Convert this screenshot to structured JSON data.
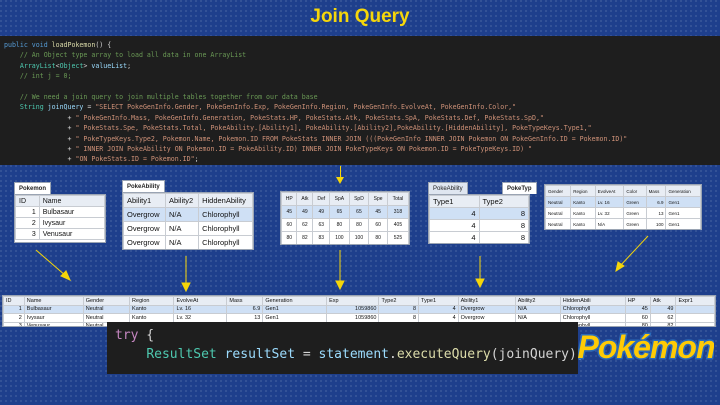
{
  "title": "Join Query",
  "code_lines": [
    {
      "parts": [
        [
          "kw",
          "public void "
        ],
        [
          "fn",
          "loadPokemon"
        ],
        [
          "",
          "() {"
        ]
      ]
    },
    {
      "parts": [
        [
          "cm",
          "    // An Object type array to load all data in one ArrayList"
        ]
      ]
    },
    {
      "parts": [
        [
          "ty",
          "    ArrayList"
        ],
        [
          "",
          "<"
        ],
        [
          "ty",
          "Object"
        ],
        [
          "",
          "> "
        ],
        [
          "id",
          "valueList"
        ],
        [
          "",
          ";"
        ]
      ]
    },
    {
      "parts": [
        [
          "cm",
          "    // int j = 0;"
        ]
      ]
    },
    {
      "parts": [
        [
          "",
          ""
        ]
      ]
    },
    {
      "parts": [
        [
          "cm",
          "    // We need a join query to join multiple tables together from our data base"
        ]
      ]
    },
    {
      "parts": [
        [
          "ty",
          "    String "
        ],
        [
          "id",
          "joinQuery"
        ],
        [
          "",
          " = "
        ],
        [
          "st",
          "\"SELECT PokeGenInfo.Gender, PokeGenInfo.Exp, PokeGenInfo.Region, PokeGenInfo.EvolveAt, PokeGenInfo.Color,\""
        ]
      ]
    },
    {
      "parts": [
        [
          "",
          "                + "
        ],
        [
          "st",
          "\" PokeGenInfo.Mass, PokeGenInfo.Generation, PokeStats.HP, PokeStats.Atk, PokeStats.SpA, PokeStats.Def, PokeStats.SpD,\""
        ]
      ]
    },
    {
      "parts": [
        [
          "",
          "                + "
        ],
        [
          "st",
          "\" PokeStats.Spe, PokeStats.Total, PokeAbility.[Ability1], PokeAbility.[Ability2],PokeAbility.[HiddenAbility], PokeTypeKeys.Type1,\""
        ]
      ]
    },
    {
      "parts": [
        [
          "",
          "                + "
        ],
        [
          "st",
          "\" PokeTypeKeys.Type2, Pokemon.Name, Pokemon.ID FROM PokeStats INNER JOIN (((PokeGenInfo INNER JOIN Pokemon ON PokeGenInfo.ID = Pokemon.ID)\""
        ]
      ]
    },
    {
      "parts": [
        [
          "",
          "                + "
        ],
        [
          "st",
          "\" INNER JOIN PokeAbility ON Pokemon.ID = PokeAbility.ID) INNER JOIN PokeTypeKeys ON Pokemon.ID = PokeTypeKeys.ID) \""
        ]
      ]
    },
    {
      "parts": [
        [
          "",
          "                + "
        ],
        [
          "st",
          "\"ON PokeStats.ID = Pokemon.ID\""
        ],
        [
          "",
          ";"
        ]
      ]
    }
  ],
  "pokemon_table": {
    "tab": "Pokemon",
    "headers": [
      "ID",
      "Name"
    ],
    "rows": [
      [
        "1",
        "Bulbasaur"
      ],
      [
        "2",
        "Ivysaur"
      ],
      [
        "3",
        "Venusaur"
      ]
    ]
  },
  "ability_table": {
    "tab": "PokeAbility",
    "headers": [
      "Ability1",
      "Ability2",
      "HiddenAbility"
    ],
    "rows": [
      [
        "Overgrow",
        "N/A",
        "Chlorophyll"
      ],
      [
        "Overgrow",
        "N/A",
        "Chlorophyll"
      ],
      [
        "Overgrow",
        "N/A",
        "Chlorophyll"
      ]
    ]
  },
  "stats_table": {
    "headers": [
      "HP",
      "Atk",
      "Def",
      "SpA",
      "SpD",
      "Spe",
      "Total"
    ],
    "rows": [
      [
        "45",
        "49",
        "49",
        "65",
        "65",
        "45",
        "318"
      ],
      [
        "60",
        "62",
        "63",
        "80",
        "80",
        "60",
        "405"
      ],
      [
        "80",
        "82",
        "83",
        "100",
        "100",
        "80",
        "525"
      ]
    ]
  },
  "types_table": {
    "tabs": [
      "PokeAbility",
      "PokeTyp"
    ],
    "headers": [
      "Type1",
      "Type2"
    ],
    "rows": [
      [
        "4",
        "8"
      ],
      [
        "4",
        "8"
      ],
      [
        "4",
        "8"
      ]
    ]
  },
  "info_table": {
    "headers": [
      "Gender",
      "Region",
      "EvolveAt",
      "Color",
      "Mass",
      "Generation"
    ],
    "rows": [
      [
        "Neutral",
        "Kanto",
        "Lv. 16",
        "Green",
        "6.9",
        "Gen1"
      ],
      [
        "Neutral",
        "Kanto",
        "Lv. 32",
        "Green",
        "13",
        "Gen1"
      ],
      [
        "Neutral",
        "Kanto",
        "N/A",
        "Green",
        "100",
        "Gen1"
      ]
    ]
  },
  "result_table": {
    "headers": [
      "ID",
      "Name",
      "Gender",
      "Region",
      "EvolveAt",
      "Mass",
      "Generation",
      "Exp",
      "Type2",
      "Type1",
      "Ability1",
      "Ability2",
      "HiddenAbili",
      "HP",
      "Atk",
      "Expr1"
    ],
    "rows": [
      [
        "1",
        "Bulbasaur",
        "Neutral",
        "Kanto",
        "Lv. 16",
        "6.9",
        "Gen1",
        "1059860",
        "8",
        "4",
        "Overgrow",
        "N/A",
        "Chlorophyll",
        "45",
        "49",
        ""
      ],
      [
        "2",
        "Ivysaur",
        "Neutral",
        "Kanto",
        "Lv. 32",
        "13",
        "Gen1",
        "1059860",
        "8",
        "4",
        "Overgrow",
        "N/A",
        "Chlorophyll",
        "60",
        "62",
        ""
      ],
      [
        "3",
        "Venusaur",
        "Neutral",
        "Kanto",
        "N/A",
        "100",
        "Gen1",
        "1059860",
        "8",
        "4",
        "Overgrow",
        "N/A",
        "Chlorophyll",
        "80",
        "82",
        ""
      ]
    ]
  },
  "try_code": {
    "line1_kw": "try",
    "line1_rest": " {",
    "line2_type": "ResultSet",
    "line2_var": " resultSet",
    "line2_eq": " = ",
    "line2_obj": "statement",
    "line2_dot": ".",
    "line2_fn": "executeQuery",
    "line2_args": "(joinQuery);"
  },
  "logo_text": "Pokémon",
  "colors": {
    "accent": "#f5d60a",
    "background": "#1e3f8c",
    "code_bg": "#1e1e1e"
  }
}
